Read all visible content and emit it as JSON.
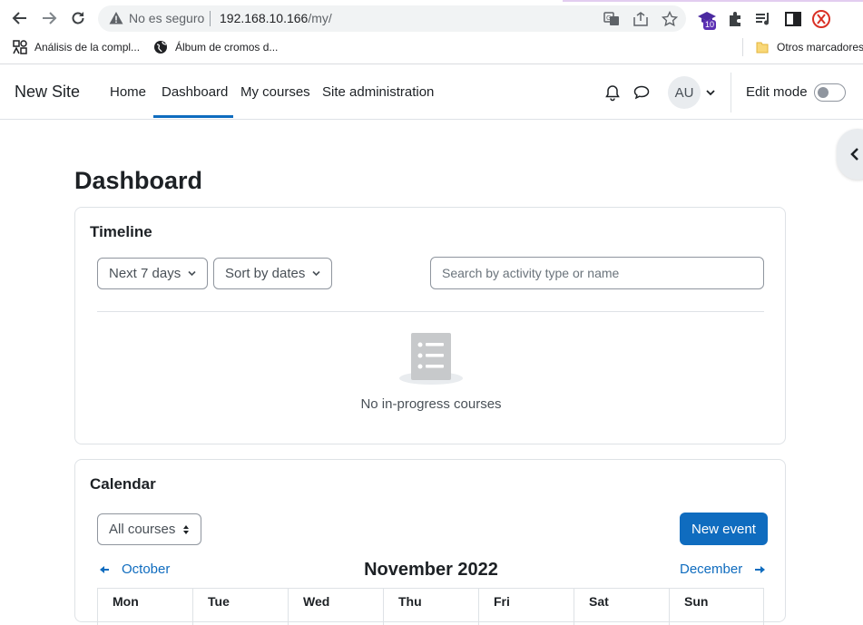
{
  "browser": {
    "security_label": "No es seguro",
    "url_host": "192.168.10.166",
    "url_path": "/my/",
    "extension_badge": "10",
    "bookmarks": [
      {
        "label": "Análisis de la compl...",
        "icon": "ai-icon"
      },
      {
        "label": "Álbum de cromos d...",
        "icon": "globe-icon"
      }
    ],
    "other_bookmarks": "Otros marcadores"
  },
  "navbar": {
    "brand": "New Site",
    "links": [
      "Home",
      "Dashboard",
      "My courses",
      "Site administration"
    ],
    "active_link": "Dashboard",
    "avatar_initials": "AU",
    "edit_mode_label": "Edit mode",
    "edit_mode_on": false
  },
  "page": {
    "title": "Dashboard"
  },
  "timeline": {
    "title": "Timeline",
    "filter_label": "Next 7 days",
    "sort_label": "Sort by dates",
    "search_placeholder": "Search by activity type or name",
    "empty_message": "No in-progress courses"
  },
  "calendar": {
    "title": "Calendar",
    "course_select": "All courses",
    "new_event_label": "New event",
    "prev_month": "October",
    "current_month": "November 2022",
    "next_month": "December",
    "weekdays": [
      "Mon",
      "Tue",
      "Wed",
      "Thu",
      "Fri",
      "Sat",
      "Sun"
    ]
  },
  "colors": {
    "brand_blue": "#0f6cbf",
    "border": "#dee2e6"
  }
}
